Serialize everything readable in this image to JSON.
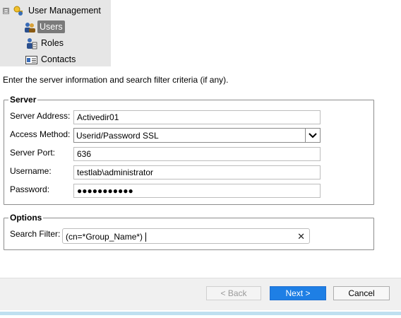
{
  "tree": {
    "root": {
      "expander": "⊟",
      "label": "User Management"
    },
    "items": [
      {
        "label": "Users",
        "selected": true
      },
      {
        "label": "Roles",
        "selected": false
      },
      {
        "label": "Contacts",
        "selected": false
      }
    ]
  },
  "intro_text": "Enter the server information and search filter criteria (if any).",
  "server": {
    "title": "Server",
    "address_label": "Server Address:",
    "address_value": "Activedir01",
    "method_label": "Access Method:",
    "method_value": "Userid/Password SSL",
    "port_label": "Server Port:",
    "port_value": "636",
    "username_label": "Username:",
    "username_value": "testlab\\administrator",
    "password_label": "Password:",
    "password_value": "●●●●●●●●●●●"
  },
  "options": {
    "title": "Options",
    "filter_label": "Search Filter:",
    "filter_value": "(cn=*Group_Name*)",
    "clear_glyph": "✕"
  },
  "buttons": {
    "back": "< Back",
    "next": "Next >",
    "cancel": "Cancel"
  },
  "colors": {
    "primary_button": "#1e7fe5",
    "selected_tree_item": "#7a7a7a",
    "accent_strip": "#bfe0f0"
  }
}
